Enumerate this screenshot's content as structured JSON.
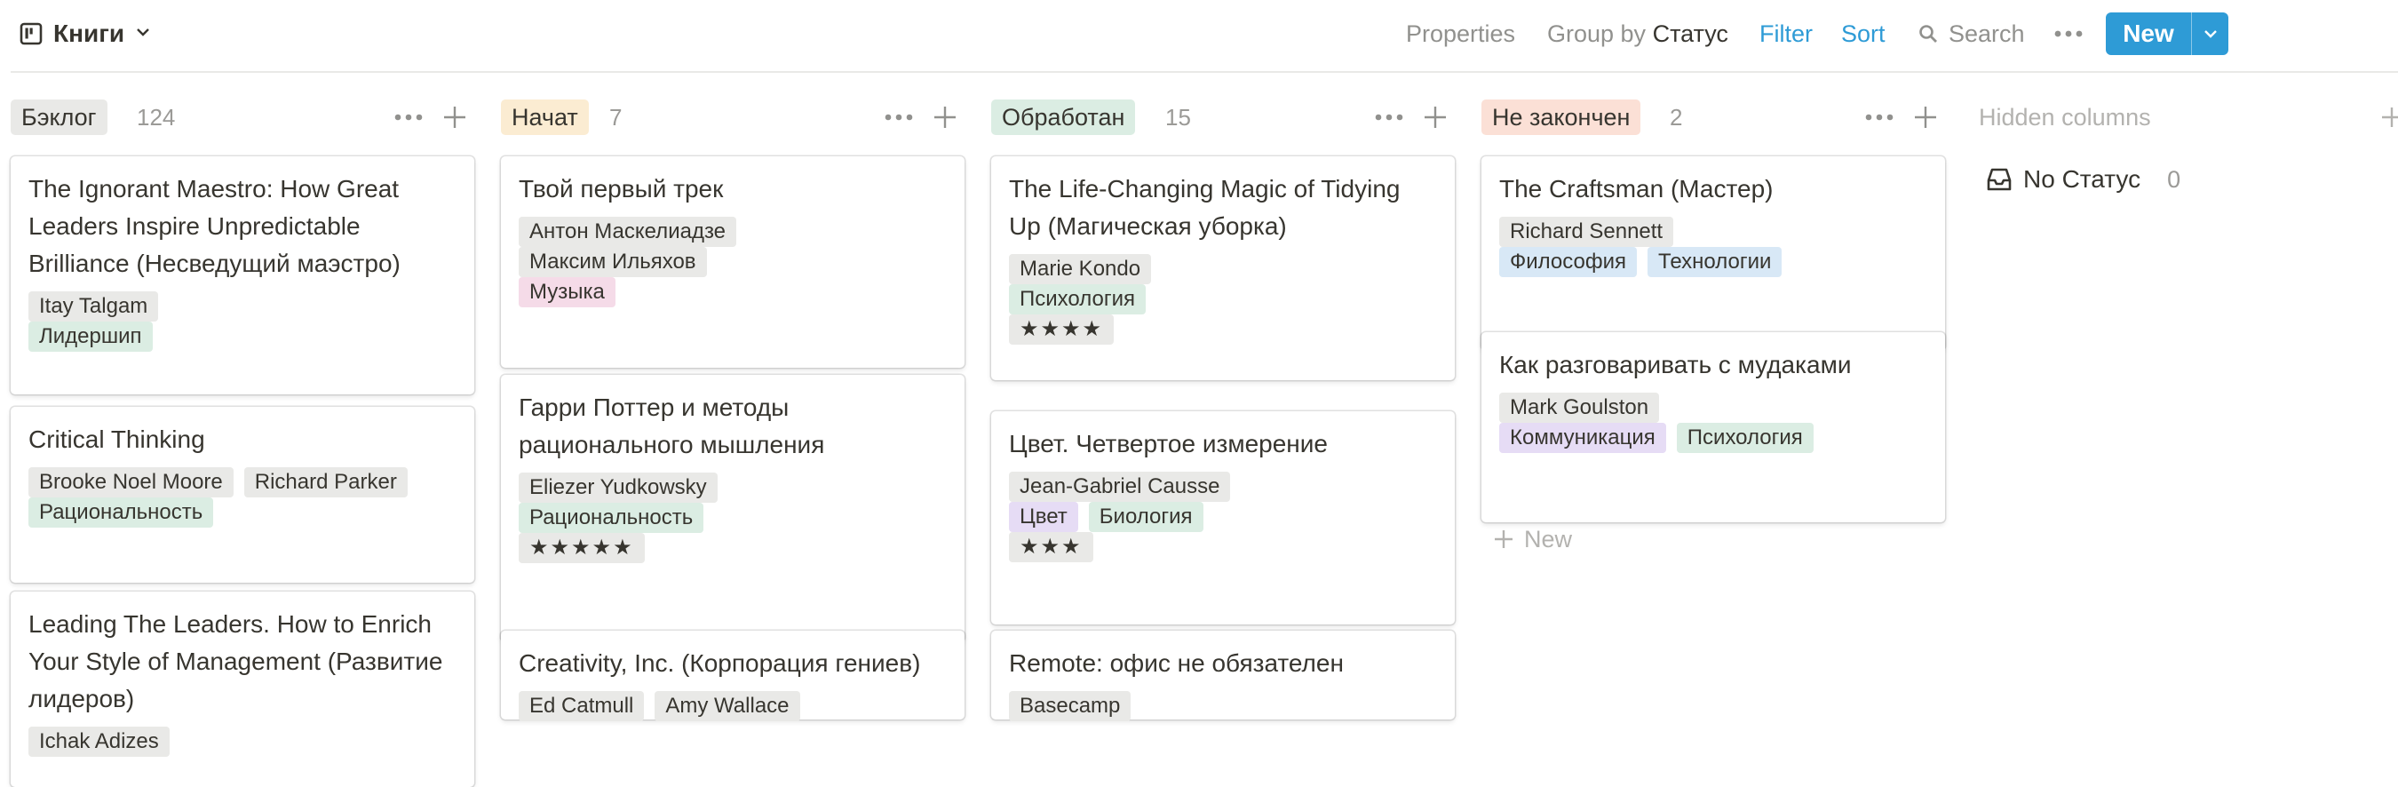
{
  "header": {
    "view_title": "Книги",
    "properties": "Properties",
    "group_by_label": "Group by",
    "group_by_value": "Статус",
    "filter": "Filter",
    "sort": "Sort",
    "search": "Search",
    "new_button": "New"
  },
  "colors": {
    "accent": "#2e9bd6"
  },
  "columns": [
    {
      "name": "Бэклог",
      "count": "124",
      "pill_color": "#e9e9e7",
      "cards": [
        {
          "title": "The Ignorant Maestro: How Great Leaders Inspire Unpredictable Brilliance (Несведущий маэстро)",
          "rows": [
            [
              {
                "t": "Itay Talgam",
                "c": "gray"
              }
            ],
            [
              {
                "t": "Лидершип",
                "c": "green"
              }
            ]
          ]
        },
        {
          "title": "Critical Thinking",
          "rows": [
            [
              {
                "t": "Brooke Noel Moore",
                "c": "gray"
              },
              {
                "t": "Richard Parker",
                "c": "gray"
              }
            ],
            [
              {
                "t": "Рациональность",
                "c": "green"
              }
            ]
          ]
        },
        {
          "title": "Leading The Leaders. How to Enrich Your Style of Management (Развитие лидеров)",
          "rows": [
            [
              {
                "t": "Ichak Adizes",
                "c": "gray"
              }
            ]
          ]
        }
      ]
    },
    {
      "name": "Начат",
      "count": "7",
      "pill_color": "#fbecd2",
      "cards": [
        {
          "title": "Твой первый трек",
          "rows": [
            [
              {
                "t": "Антон Маскелиадзе",
                "c": "gray"
              }
            ],
            [
              {
                "t": "Максим Ильяхов",
                "c": "gray"
              }
            ],
            [
              {
                "t": "Музыка",
                "c": "pink"
              }
            ]
          ]
        },
        {
          "title": "Гарри Поттер и методы рационального мышления",
          "rows": [
            [
              {
                "t": "Eliezer Yudkowsky",
                "c": "gray"
              }
            ],
            [
              {
                "t": "Рациональность",
                "c": "green"
              }
            ],
            [
              {
                "t": "★★★★★",
                "c": "stars"
              }
            ]
          ]
        },
        {
          "title": "Creativity, Inc. (Корпорация гениев)",
          "rows": [
            [
              {
                "t": "Ed Catmull",
                "c": "gray"
              },
              {
                "t": "Amy Wallace",
                "c": "gray"
              }
            ]
          ]
        }
      ]
    },
    {
      "name": "Обработан",
      "count": "15",
      "pill_color": "#dbede3",
      "cards": [
        {
          "title": "The Life-Changing Magic of Tidying Up (Магическая уборка)",
          "rows": [
            [
              {
                "t": "Marie Kondo",
                "c": "gray"
              }
            ],
            [
              {
                "t": "Психология",
                "c": "green"
              }
            ],
            [
              {
                "t": "★★★★",
                "c": "stars"
              }
            ]
          ]
        },
        {
          "title": "Цвет. Четвертое измерение",
          "rows": [
            [
              {
                "t": "Jean-Gabriel Causse",
                "c": "gray"
              }
            ],
            [
              {
                "t": "Цвет",
                "c": "purple"
              },
              {
                "t": "Биология",
                "c": "green"
              }
            ],
            [
              {
                "t": "★★★",
                "c": "stars"
              }
            ]
          ]
        },
        {
          "title": "Remote: офис не обязателен",
          "rows": [
            [
              {
                "t": "Basecamp",
                "c": "gray"
              }
            ]
          ]
        }
      ]
    },
    {
      "name": "Не закончен",
      "count": "2",
      "pill_color": "#fbe0d6",
      "cards": [
        {
          "title": "The Craftsman (Мастер)",
          "rows": [
            [
              {
                "t": "Richard Sennett",
                "c": "gray"
              }
            ],
            [
              {
                "t": "Философия",
                "c": "blue"
              },
              {
                "t": "Технологии",
                "c": "blue"
              }
            ]
          ]
        },
        {
          "title": "Как разговаривать с мудаками",
          "rows": [
            [
              {
                "t": "Mark Goulston",
                "c": "gray"
              }
            ],
            [
              {
                "t": "Коммуникация",
                "c": "purple"
              },
              {
                "t": "Психология",
                "c": "green"
              }
            ]
          ]
        }
      ]
    }
  ],
  "new_card_label": "New",
  "hidden_columns": {
    "title": "Hidden columns",
    "items": [
      {
        "label": "No Статус",
        "count": "0"
      }
    ]
  }
}
